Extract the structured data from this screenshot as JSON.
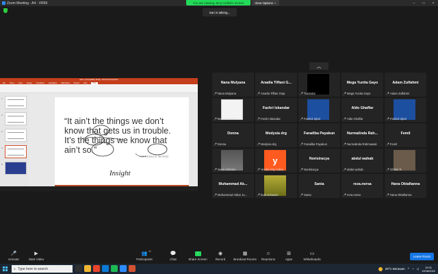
{
  "window": {
    "title": "Zoom Meeting - A4 - VR69",
    "controls": [
      "–",
      "□",
      "×"
    ]
  },
  "banner": {
    "viewing": "You are viewing Jerry Holkal's screen",
    "view_options": "View Options",
    "view_options_caret": "⌄"
  },
  "talking_indicator": "Sari is talking...",
  "shared_screen": {
    "ppt_window_title": "slide 1 [Compatibility Mode] - Microsoft PowerPoint",
    "ppt_tabs": [
      "File",
      "Home",
      "Insert",
      "Design",
      "Transitions",
      "Animations",
      "Slide Show",
      "Review",
      "View",
      "Help"
    ],
    "ppt_active_tab": "Help",
    "thumb_numbers": [
      "1",
      "2",
      "3",
      "4",
      "5"
    ],
    "quote": "“It ain’t the things we don’t know that gets us in trouble. It’s the things we know that ain’t so.”",
    "author": "ARTEMUS WARD",
    "handwriting": "Insight"
  },
  "gallery": {
    "up_arrow": "︿",
    "tiles": [
      {
        "name": "Nana Mulyana",
        "sub": "Nana Mulyana",
        "media": "none"
      },
      {
        "name": "Anadia Tiffani G...",
        "sub": "Anadia Tiffani Geja",
        "media": "none"
      },
      {
        "name": "",
        "sub": "Tuwindar",
        "media": "black"
      },
      {
        "name": "Mega Yunita Gayo",
        "sub": "Mega Yunita Gayo",
        "media": "none"
      },
      {
        "name": "Adam Zulfahmi",
        "sub": "Adam Zulfahmi",
        "media": "none"
      },
      {
        "name": "",
        "sub": "Bestol Fahmi M...",
        "media": "sketch"
      },
      {
        "name": "Fachri Iskandar",
        "sub": "Fachri Iskandar",
        "media": "none"
      },
      {
        "name": "",
        "sub": "Faishal Iqbal",
        "media": "person"
      },
      {
        "name": "Aldo Ghaffar",
        "sub": "Aldo Ghaffar",
        "media": "none"
      },
      {
        "name": "",
        "sub": "Faishal Iqbal",
        "media": "person"
      },
      {
        "name": "Donna",
        "sub": "Donna",
        "media": "none"
      },
      {
        "name": "Medysia drg",
        "sub": "Medysia drg",
        "media": "none"
      },
      {
        "name": "Faradiba Payakun",
        "sub": "Faradiba Payakun",
        "media": "none"
      },
      {
        "name": "Nurmalinda Rah...",
        "sub": "Nurmalinda Rahmawati",
        "media": "none"
      },
      {
        "name": "Femil",
        "sub": "Femil",
        "media": "none"
      },
      {
        "name": "",
        "sub": "Nuria Sofiatun",
        "media": "grey"
      },
      {
        "name": "",
        "sub": "Yesika Visy Indria",
        "media": "logo",
        "logo_text": "y"
      },
      {
        "name": "Noristracya",
        "sub": "Noristracya",
        "media": "none"
      },
      {
        "name": "abdul wahab",
        "sub": "abdul wahab",
        "media": "none"
      },
      {
        "name": "",
        "sub": "Ghifari R.",
        "media": "person2"
      },
      {
        "name": "Muhammad Ak...",
        "sub": "Muhammad Akbar Ju...",
        "media": "none"
      },
      {
        "name": "",
        "sub": "budi setiawan",
        "media": "plant"
      },
      {
        "name": "Sania",
        "sub": "Sania",
        "media": "none"
      },
      {
        "name": "reza.norsa",
        "sub": "reza.norsa",
        "media": "none"
      },
      {
        "name": "Hana Oktafianna",
        "sub": "Hana Oktafianna",
        "media": "none"
      }
    ]
  },
  "toolbar": {
    "unmute": "Unmute",
    "start_video": "Start Video",
    "participants": "Participants",
    "participants_count": "41",
    "chat": "Chat",
    "share_screen": "Share Screen",
    "record": "Record",
    "breakout": "Breakout Rooms",
    "reactions": "Reactions",
    "apps": "Apps",
    "whiteboards": "Whiteboards",
    "leave": "Leave Room"
  },
  "taskbar": {
    "search_placeholder": "Type here to search",
    "weather": "29°C  Berawan",
    "time": "19:31",
    "date": "12/08/2022",
    "app_colors": [
      "#2f2f2f",
      "#f2b632",
      "#e8452c",
      "#0b7bd6",
      "#1db954",
      "#2d8cff",
      "#d35230"
    ]
  }
}
